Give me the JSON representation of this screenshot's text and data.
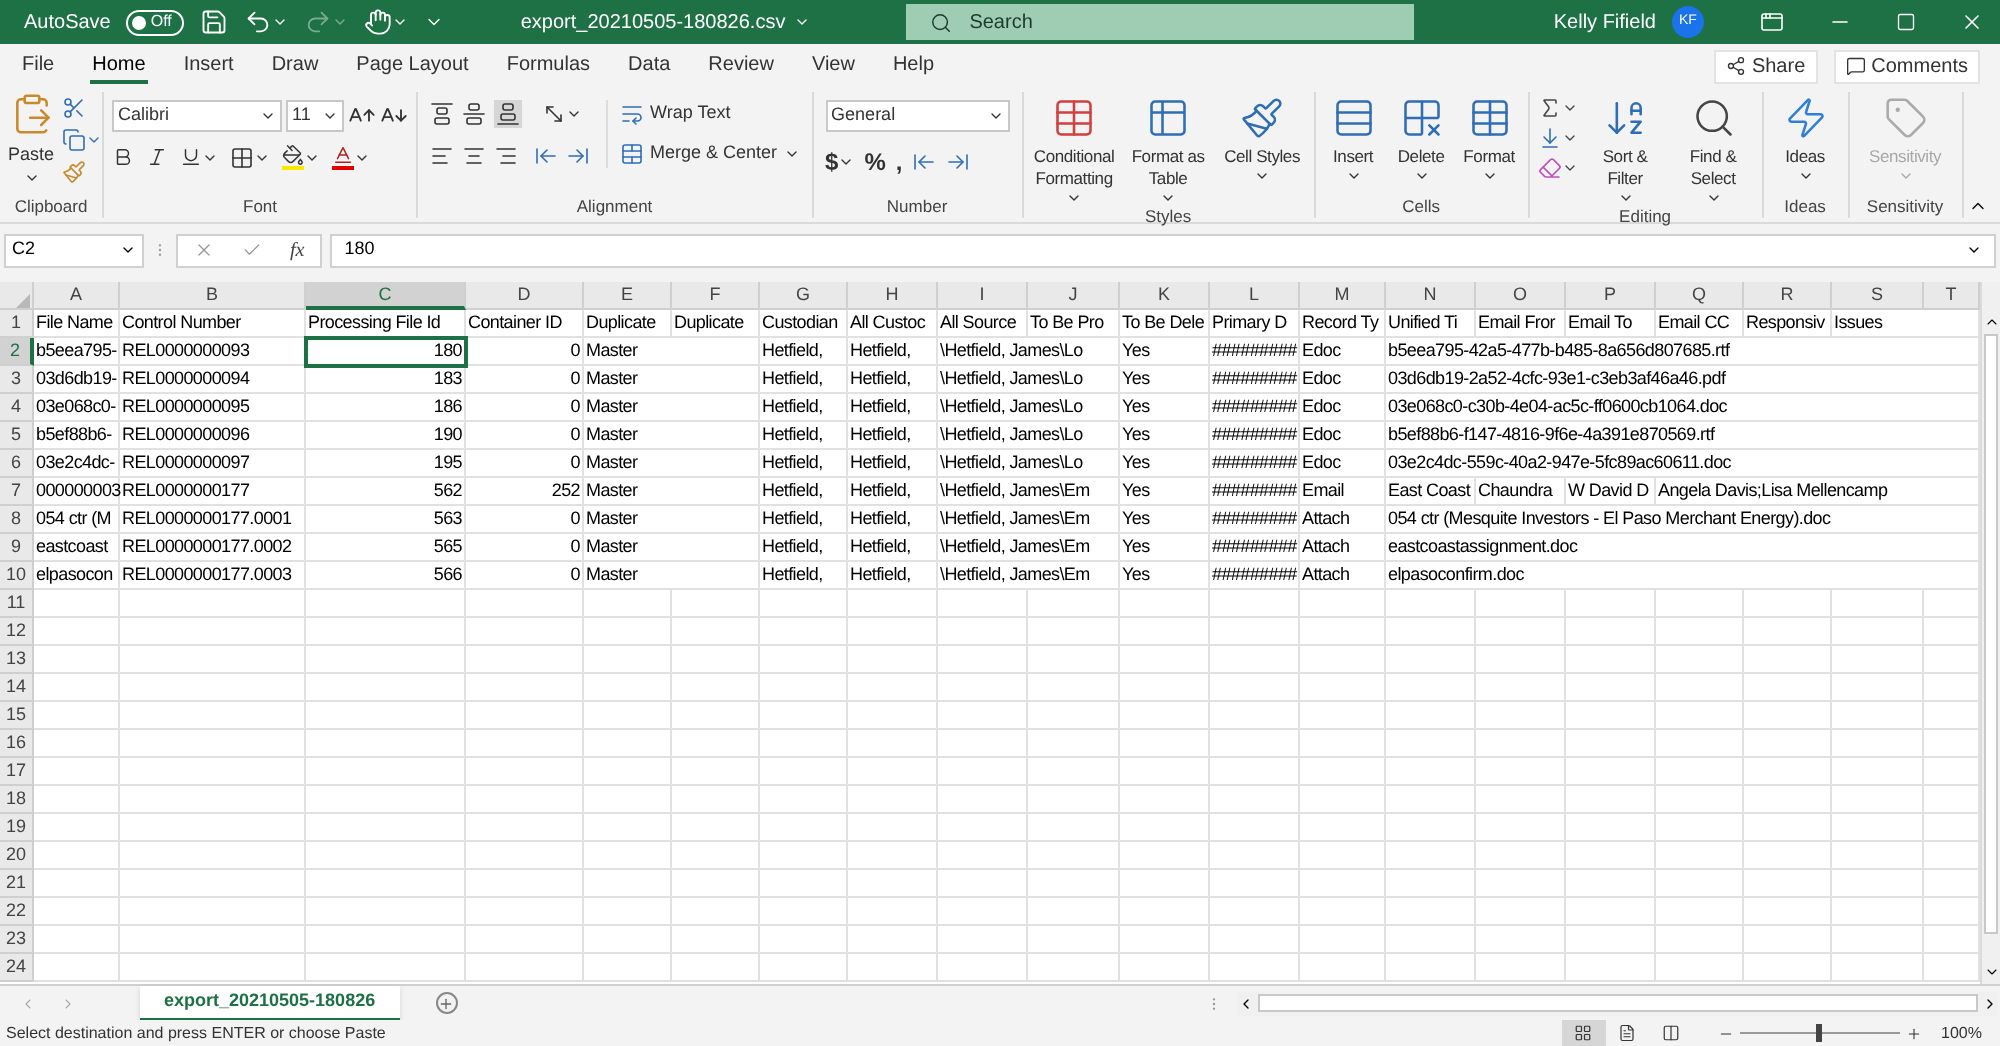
{
  "title_bar": {
    "autosave_label": "AutoSave",
    "autosave": {
      "on": false,
      "label": "Off"
    },
    "file_name": "export_20210505-180826.csv",
    "search": {
      "placeholder": "Search"
    },
    "user": "Kelly Fifield",
    "avatar": "KF"
  },
  "menu": {
    "tabs": [
      {
        "label": "File",
        "selected": false
      },
      {
        "label": "Home",
        "selected": true
      },
      {
        "label": "Insert",
        "selected": false
      },
      {
        "label": "Draw",
        "selected": false
      },
      {
        "label": "Page Layout",
        "selected": false
      },
      {
        "label": "Formulas",
        "selected": false
      },
      {
        "label": "Data",
        "selected": false
      },
      {
        "label": "Review",
        "selected": false
      },
      {
        "label": "View",
        "selected": false
      },
      {
        "label": "Help",
        "selected": false
      }
    ],
    "share": "Share",
    "comments": "Comments"
  },
  "ribbon": {
    "groups": [
      {
        "kind": "clipboard",
        "label": "Clipboard",
        "paste": "Paste"
      },
      {
        "kind": "font",
        "label": "Font",
        "font": "Calibri",
        "size": "11"
      },
      {
        "kind": "alignment",
        "label": "Alignment",
        "wrap": "Wrap Text",
        "merge": "Merge & Center"
      },
      {
        "kind": "number",
        "label": "Number",
        "format": "General",
        "symbols": [
          "$",
          "%",
          ","
        ]
      },
      {
        "kind": "buttons",
        "label": "Styles",
        "buttons": [
          {
            "label": "Conditional Formatting",
            "disabled": false
          },
          {
            "label": "Format as Table",
            "disabled": false
          },
          {
            "label": "Cell Styles",
            "disabled": false
          }
        ]
      },
      {
        "kind": "buttons",
        "label": "Cells",
        "buttons": [
          {
            "label": "Insert",
            "disabled": false
          },
          {
            "label": "Delete",
            "disabled": false
          },
          {
            "label": "Format",
            "disabled": false
          }
        ]
      },
      {
        "kind": "editing",
        "label": "Editing",
        "buttons": [
          {
            "label": "Sort & Filter",
            "disabled": false
          },
          {
            "label": "Find & Select",
            "disabled": false
          }
        ]
      },
      {
        "kind": "buttons",
        "label": "Ideas",
        "buttons": [
          {
            "label": "Ideas",
            "disabled": false
          }
        ]
      },
      {
        "kind": "buttons",
        "label": "Sensitivity",
        "buttons": [
          {
            "label": "Sensitivity",
            "disabled": true
          }
        ]
      }
    ]
  },
  "formula_bar": {
    "name_box": "C2",
    "fx": "fx",
    "value": "180"
  },
  "sheet": {
    "columns": [
      {
        "letter": "A",
        "selected": false
      },
      {
        "letter": "B",
        "selected": false
      },
      {
        "letter": "C",
        "selected": true
      },
      {
        "letter": "D",
        "selected": false
      },
      {
        "letter": "E",
        "selected": false
      },
      {
        "letter": "F",
        "selected": false
      },
      {
        "letter": "G",
        "selected": false
      },
      {
        "letter": "H",
        "selected": false
      },
      {
        "letter": "I",
        "selected": false
      },
      {
        "letter": "J",
        "selected": false
      },
      {
        "letter": "K",
        "selected": false
      },
      {
        "letter": "L",
        "selected": false
      },
      {
        "letter": "M",
        "selected": false
      },
      {
        "letter": "N",
        "selected": false
      },
      {
        "letter": "O",
        "selected": false
      },
      {
        "letter": "P",
        "selected": false
      },
      {
        "letter": "Q",
        "selected": false
      },
      {
        "letter": "R",
        "selected": false
      },
      {
        "letter": "S",
        "selected": false
      },
      {
        "letter": "T",
        "selected": false
      }
    ],
    "rows": [
      {
        "number": "1",
        "selected": false,
        "cells": [
          "File Name",
          "Control Number",
          "Processing File Id",
          "Container ID",
          "Duplicate",
          "Duplicate",
          "Custodian",
          "All Custoc",
          "All Source",
          "To Be Pro",
          "To Be Dele",
          "Primary D",
          "Record Ty",
          "Unified Ti",
          "Email Fror",
          "Email To",
          "Email CC",
          "Responsiv",
          "Issues"
        ]
      },
      {
        "number": "2",
        "selected": true,
        "cells": [
          "b5eea795-",
          "REL0000000093",
          {
            "text": "180",
            "kind": "number"
          },
          {
            "text": "0",
            "kind": "number"
          },
          "Master",
          null,
          "Hetfield,",
          "Hetfield,",
          "\\Hetfield, James\\Lo",
          null,
          "Yes",
          "#########",
          "Edoc",
          "b5eea795-42a5-477b-b485-8a656d807685.rtf"
        ]
      },
      {
        "number": "3",
        "selected": false,
        "cells": [
          "03d6db19-",
          "REL0000000094",
          {
            "text": "183",
            "kind": "number"
          },
          {
            "text": "0",
            "kind": "number"
          },
          "Master",
          null,
          "Hetfield,",
          "Hetfield,",
          "\\Hetfield, James\\Lo",
          null,
          "Yes",
          "#########",
          "Edoc",
          "03d6db19-2a52-4cfc-93e1-c3eb3af46a46.pdf"
        ]
      },
      {
        "number": "4",
        "selected": false,
        "cells": [
          "03e068c0-",
          "REL0000000095",
          {
            "text": "186",
            "kind": "number"
          },
          {
            "text": "0",
            "kind": "number"
          },
          "Master",
          null,
          "Hetfield,",
          "Hetfield,",
          "\\Hetfield, James\\Lo",
          null,
          "Yes",
          "#########",
          "Edoc",
          "03e068c0-c30b-4e04-ac5c-ff0600cb1064.doc"
        ]
      },
      {
        "number": "5",
        "selected": false,
        "cells": [
          "b5ef88b6-",
          "REL0000000096",
          {
            "text": "190",
            "kind": "number"
          },
          {
            "text": "0",
            "kind": "number"
          },
          "Master",
          null,
          "Hetfield,",
          "Hetfield,",
          "\\Hetfield, James\\Lo",
          null,
          "Yes",
          "#########",
          "Edoc",
          "b5ef88b6-f147-4816-9f6e-4a391e870569.rtf"
        ]
      },
      {
        "number": "6",
        "selected": false,
        "cells": [
          "03e2c4dc-",
          "REL0000000097",
          {
            "text": "195",
            "kind": "number"
          },
          {
            "text": "0",
            "kind": "number"
          },
          "Master",
          null,
          "Hetfield,",
          "Hetfield,",
          "\\Hetfield, James\\Lo",
          null,
          "Yes",
          "#########",
          "Edoc",
          "03e2c4dc-559c-40a2-947e-5fc89ac60611.doc"
        ]
      },
      {
        "number": "7",
        "selected": false,
        "cells": [
          "000000003",
          "REL0000000177",
          {
            "text": "562",
            "kind": "number"
          },
          {
            "text": "252",
            "kind": "number"
          },
          "Master",
          null,
          "Hetfield,",
          "Hetfield,",
          "\\Hetfield, James\\Em",
          null,
          "Yes",
          "#########",
          "Email",
          "East Coast",
          "Chaundra",
          "W David D",
          "Angela Davis;Lisa Mellencamp"
        ]
      },
      {
        "number": "8",
        "selected": false,
        "cells": [
          "054 ctr (M",
          "REL0000000177.0001",
          {
            "text": "563",
            "kind": "number"
          },
          {
            "text": "0",
            "kind": "number"
          },
          "Master",
          null,
          "Hetfield,",
          "Hetfield,",
          "\\Hetfield, James\\Em",
          null,
          "Yes",
          "#########",
          "Attach",
          "054 ctr (Mesquite Investors - El Paso Merchant Energy).doc"
        ]
      },
      {
        "number": "9",
        "selected": false,
        "cells": [
          "eastcoast",
          "REL0000000177.0002",
          {
            "text": "565",
            "kind": "number"
          },
          {
            "text": "0",
            "kind": "number"
          },
          "Master",
          null,
          "Hetfield,",
          "Hetfield,",
          "\\Hetfield, James\\Em",
          null,
          "Yes",
          "#########",
          "Attach",
          "eastcoastassignment.doc"
        ]
      },
      {
        "number": "10",
        "selected": false,
        "cells": [
          "elpasocon",
          "REL0000000177.0003",
          {
            "text": "566",
            "kind": "number"
          },
          {
            "text": "0",
            "kind": "number"
          },
          "Master",
          null,
          "Hetfield,",
          "Hetfield,",
          "\\Hetfield, James\\Em",
          null,
          "Yes",
          "#########",
          "Attach",
          "elpasoconfirm.doc"
        ]
      }
    ],
    "empty_rows": [
      "11",
      "12",
      "13",
      "14",
      "15",
      "16",
      "17",
      "18",
      "19",
      "20",
      "21",
      "22",
      "23",
      "24"
    ]
  },
  "sheet_tabs": [
    {
      "label": "export_20210505-180826",
      "selected": true
    }
  ],
  "status_bar": {
    "message": "Select destination and press ENTER or choose Paste",
    "views": [
      {
        "kind": "normal",
        "selected": true
      },
      {
        "kind": "page_layout",
        "selected": false
      },
      {
        "kind": "page_break",
        "selected": false
      }
    ],
    "zoom": {
      "level": 0.5,
      "reading": "100%"
    }
  }
}
